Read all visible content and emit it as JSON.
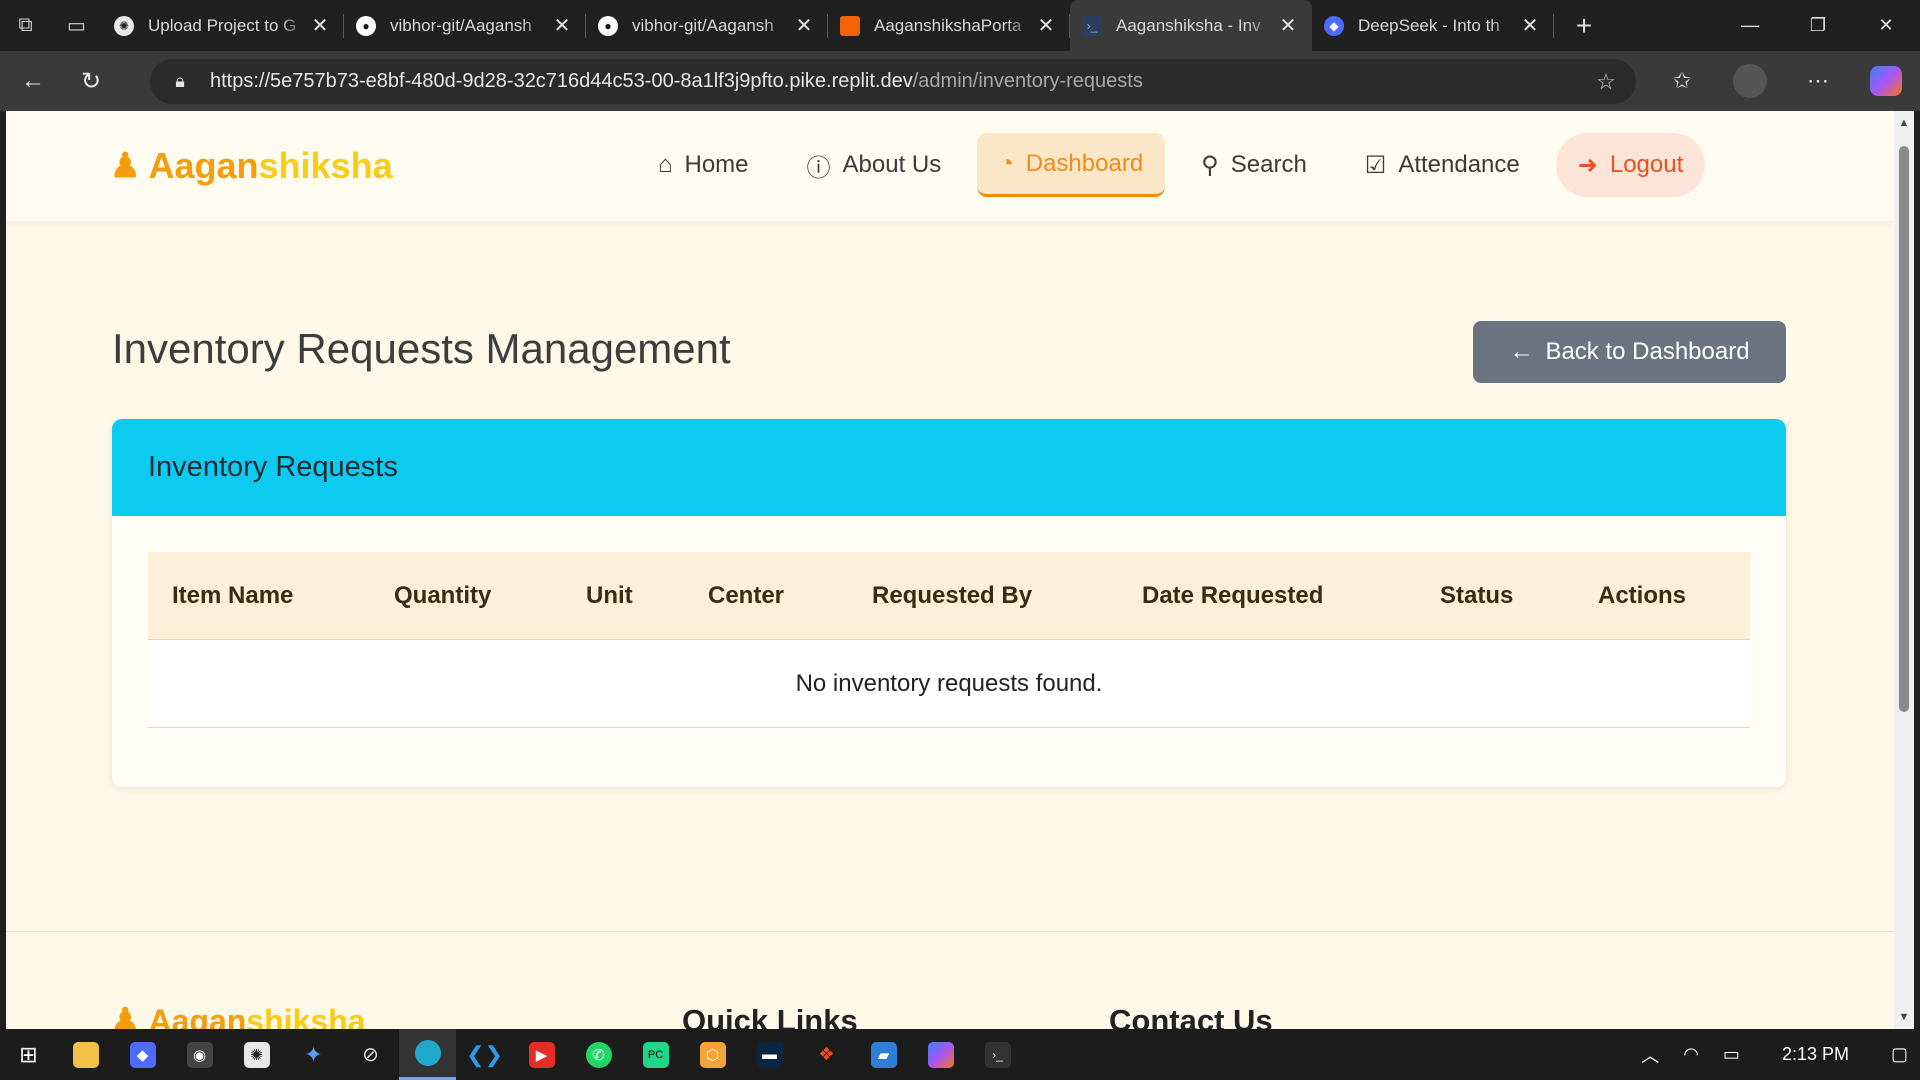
{
  "browser": {
    "tabs": [
      {
        "title": "Upload Project to G",
        "icon": "openai-icon",
        "color": "#e8e8e8"
      },
      {
        "title": "vibhor-git/Aagansh",
        "icon": "github-icon",
        "color": "#ffffff"
      },
      {
        "title": "vibhor-git/Aagansh",
        "icon": "github-icon",
        "color": "#ffffff"
      },
      {
        "title": "AaganshikshaPorta",
        "icon": "replit-icon",
        "color": "#f26207"
      },
      {
        "title": "Aaganshiksha - Inv",
        "icon": "terminal-icon",
        "color": "#5a8dd6",
        "active": true
      },
      {
        "title": "DeepSeek - Into th",
        "icon": "deepseek-icon",
        "color": "#4d6bfe"
      }
    ],
    "url_main": "https://5e757b73-e8bf-480d-9d28-32c716d44c53-00-8a1lf3j9pfto.pike.replit.dev",
    "url_path": "/admin/inventory-requests"
  },
  "site": {
    "brand_part1": "Aagan",
    "brand_part2": "shiksha",
    "nav": {
      "home": "Home",
      "about": "About Us",
      "dashboard": "Dashboard",
      "search": "Search",
      "attendance": "Attendance",
      "logout": "Logout"
    }
  },
  "page": {
    "title": "Inventory Requests Management",
    "back_button": "Back to Dashboard",
    "card_title": "Inventory Requests",
    "columns": [
      "Item Name",
      "Quantity",
      "Unit",
      "Center",
      "Requested By",
      "Date Requested",
      "Status",
      "Actions"
    ],
    "empty_message": "No inventory requests found."
  },
  "footer": {
    "brand_part1": "Aagan",
    "brand_part2": "shiksha",
    "quick_links": "Quick Links",
    "contact": "Contact Us"
  },
  "taskbar": {
    "time": "2:13 PM"
  },
  "colors": {
    "accent_orange": "#f08c12",
    "card_header": "#0dcaf0",
    "back_button": "#6b7280",
    "page_bg": "#fdf8e8"
  }
}
